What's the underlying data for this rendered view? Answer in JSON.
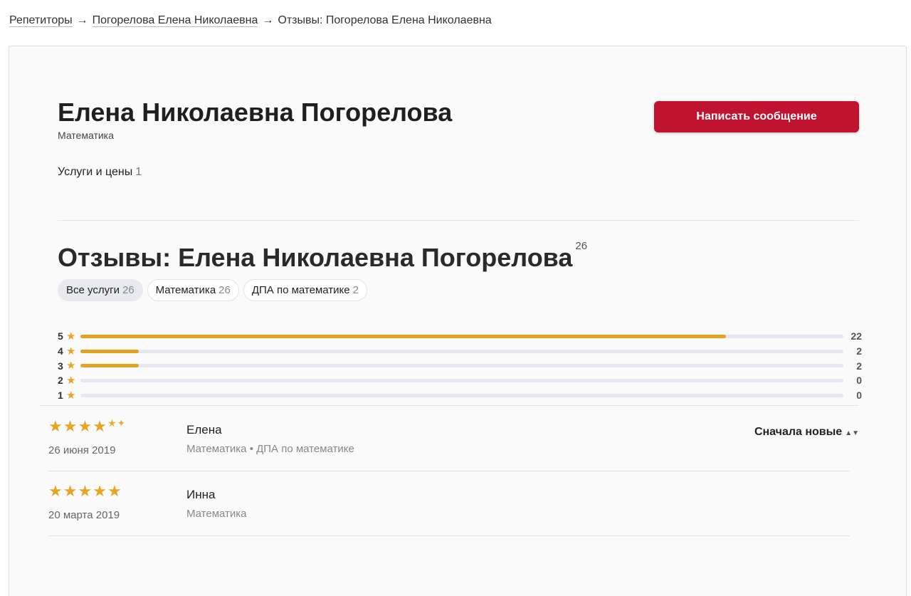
{
  "breadcrumb": {
    "items": [
      "Репетиторы",
      "Погорелова Елена Николаевна"
    ],
    "current": "Отзывы: Погорелова Елена Николаевна",
    "separator": "→"
  },
  "profile": {
    "name": "Елена Николаевна Погорелова",
    "subject": "Математика",
    "message_button": "Написать сообщение",
    "services_label": "Услуги и цены",
    "services_count": "1"
  },
  "reviews_section": {
    "title": "Отзывы: Елена Николаевна Погорелова",
    "total": "26",
    "filters": [
      {
        "label": "Все услуги",
        "count": "26",
        "active": true
      },
      {
        "label": "Математика",
        "count": "26",
        "active": false
      },
      {
        "label": "ДПА по математике",
        "count": "2",
        "active": false
      }
    ],
    "distribution": [
      {
        "stars": "5",
        "count": 22
      },
      {
        "stars": "4",
        "count": 2
      },
      {
        "stars": "3",
        "count": 2
      },
      {
        "stars": "2",
        "count": 0
      },
      {
        "stars": "1",
        "count": 0
      }
    ],
    "sort_label": "Сначала новые",
    "reviews": [
      {
        "rating": 4.5,
        "date": "26 июня 2019",
        "author": "Елена",
        "subjects": "Математика • ДПА по математике"
      },
      {
        "rating": 5,
        "date": "20 марта 2019",
        "author": "Инна",
        "subjects": "Математика"
      }
    ]
  },
  "colors": {
    "accent": "#bf1330",
    "star": "#e6a623",
    "bar_fill": "#e3a31f",
    "bar_track": "#e6e8ef"
  },
  "icons": {
    "star": "star-icon",
    "breadcrumb_arrow": "arrow-right-icon",
    "sort": "sort-arrows-icon"
  }
}
